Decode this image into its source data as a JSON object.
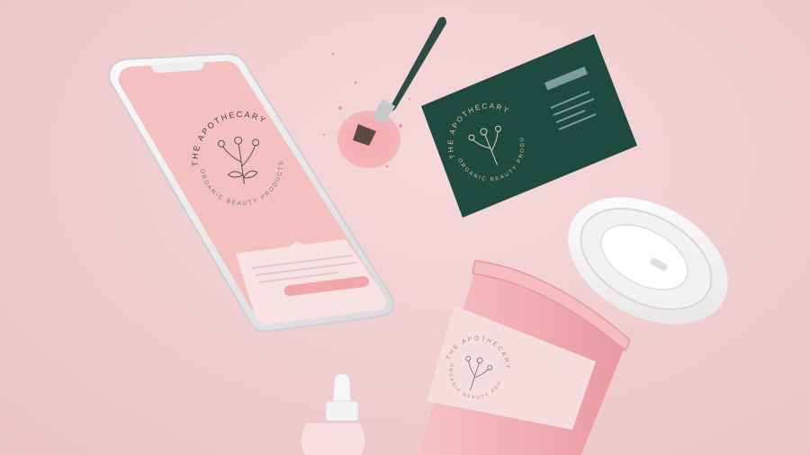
{
  "brand": {
    "name": "THE APOTHECARY",
    "tagline": "ORGANIC BEAUTY PRODUCTS"
  },
  "colors": {
    "background": "#f1cfd1",
    "card_green": "#1f4a3f",
    "cup_pink": "#f2b3b8",
    "phone_screen_pink": "#f4c1c0",
    "accent_pink": "#f3a9ad"
  }
}
